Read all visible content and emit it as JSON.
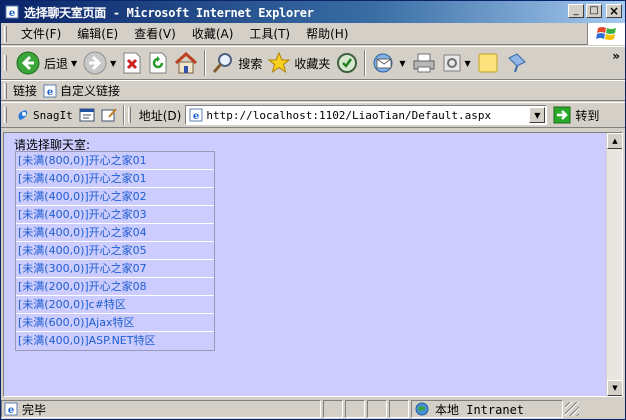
{
  "window": {
    "title": "选择聊天室页面 - Microsoft Internet Explorer",
    "controls": {
      "minimize": "_",
      "maximize": "□",
      "close": "×"
    }
  },
  "menu": {
    "items": [
      "文件(F)",
      "编辑(E)",
      "查看(V)",
      "收藏(A)",
      "工具(T)",
      "帮助(H)"
    ]
  },
  "toolbar": {
    "back_label": "后退",
    "search_label": "搜索",
    "favorites_label": "收藏夹",
    "more": "»"
  },
  "links": {
    "label": "链接",
    "custom_link": "自定义链接"
  },
  "snagit": {
    "label": "SnagIt"
  },
  "address": {
    "label": "地址(D)",
    "url": "http://localhost:1102/LiaoTian/Default.aspx",
    "go_label": "转到"
  },
  "content": {
    "heading": "请选择聊天室:",
    "rooms": [
      "[未满(800,0)]开心之家01",
      "[未满(400,0)]开心之家01",
      "[未满(400,0)]开心之家02",
      "[未满(400,0)]开心之家03",
      "[未满(400,0)]开心之家04",
      "[未满(400,0)]开心之家05",
      "[未满(300,0)]开心之家07",
      "[未满(200,0)]开心之家08",
      "[未满(200,0)]c#特区",
      "[未满(600,0)]Ajax特区",
      "[未满(400,0)]ASP.NET特区"
    ]
  },
  "status": {
    "text": "完毕",
    "zone": "本地 Intranet"
  },
  "colors": {
    "page_background": "#ccccff",
    "link_text": "#1e5fd0",
    "titlebar": "#0a246a"
  }
}
